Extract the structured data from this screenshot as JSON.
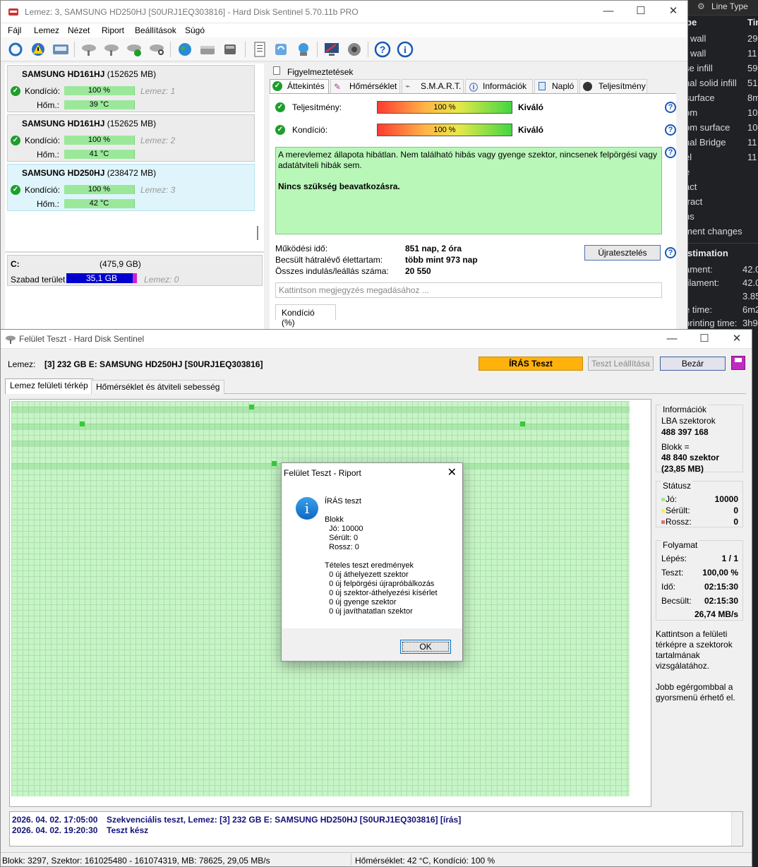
{
  "bg_app": {
    "header_label": "Line Type",
    "col_type": "pe",
    "col_time": "Tim",
    "rows": [
      {
        "name": "r wall",
        "value": "29"
      },
      {
        "name": "r wall",
        "value": "11"
      },
      {
        "name": "se infill",
        "value": "59"
      },
      {
        "name": "nal solid infill",
        "value": "51"
      },
      {
        "name": "surface",
        "value": "8m"
      },
      {
        "name": "om",
        "value": "10"
      },
      {
        "name": "om surface",
        "value": "10"
      },
      {
        "name": "nal Bridge",
        "value": "11"
      },
      {
        "name": "el",
        "value": "11"
      },
      {
        "name": "e",
        "value": ""
      },
      {
        "name": "act",
        "value": ""
      },
      {
        "name": "tract",
        "value": ""
      },
      {
        "name": "ns",
        "value": ""
      },
      {
        "name": "ment changes",
        "value": ""
      }
    ],
    "section_title": "stimation",
    "est_rows": [
      {
        "name": "ament:",
        "value": "42.0"
      },
      {
        "name": "filament:",
        "value": "42.0"
      },
      {
        "name": "",
        "value": "3.85"
      },
      {
        "name": "e time:",
        "value": "6m2"
      },
      {
        "name": "printing time:",
        "value": "3h9"
      }
    ]
  },
  "main_window": {
    "title": "Lemez: 3, SAMSUNG HD250HJ [S0URJ1EQ303816]  -  Hard Disk Sentinel 5.70.11b PRO",
    "menu": [
      "Fájl",
      "Lemez",
      "Nézet",
      "Riport",
      "Beállítások",
      "Súgó"
    ],
    "disks": [
      {
        "name": "SAMSUNG HD161HJ",
        "size": "(152625 MB)",
        "kondicio_label": "Kondíció:",
        "kondicio": "100 %",
        "hom_label": "Hőm.:",
        "hom": "39 °C",
        "lemez": "Lemez: 1"
      },
      {
        "name": "SAMSUNG HD161HJ",
        "size": "(152625 MB)",
        "kondicio_label": "Kondíció:",
        "kondicio": "100 %",
        "hom_label": "Hőm.:",
        "hom": "41 °C",
        "lemez": "Lemez: 2"
      },
      {
        "name": "SAMSUNG HD250HJ",
        "size": "(238472 MB)",
        "kondicio_label": "Kondíció:",
        "kondicio": "100 %",
        "hom_label": "Hőm.:",
        "hom": "42 °C",
        "lemez": "Lemez: 3"
      }
    ],
    "partition": {
      "drive": "C:",
      "size": "(475,9 GB)",
      "free_label": "Szabad terület",
      "free": "35,1 GB",
      "lemez": "Lemez: 0"
    },
    "tabs_top": {
      "figyelmeztetesek": "Figyelmeztetések"
    },
    "tabs": [
      "Áttekintés",
      "Hőmérséklet",
      "S.M.A.R.T.",
      "Információk",
      "Napló",
      "Teljesítmény"
    ],
    "teljesitmeny_label": "Teljesítmény:",
    "teljesitmeny_value": "100 %",
    "teljesitmeny_rating": "Kiváló",
    "kondicio_label": "Kondíció:",
    "kondicio_value": "100 %",
    "kondicio_rating": "Kiváló",
    "status_text": "A merevlemez állapota hibátlan. Nem található hibás vagy gyenge szektor, nincsenek felpörgési vagy adatátviteli hibák sem.",
    "status_bold": "Nincs szükség beavatkozásra.",
    "stats": [
      {
        "label": "Működési idő:",
        "value": "851 nap, 2 óra"
      },
      {
        "label": "Becsült hátralévő élettartam:",
        "value": "több mint 973 nap"
      },
      {
        "label": "Összes indulás/leállás száma:",
        "value": "20 550"
      }
    ],
    "retest_button": "Újratesztelés",
    "note_placeholder": "Kattintson megjegyzés megadásához ...",
    "kondicio_tab": "Kondíció  (%)"
  },
  "surface_window": {
    "title": "Felület Teszt - Hard Disk Sentinel",
    "lemez_label": "Lemez:",
    "lemez_value": "[3] 232 GB E: SAMSUNG HD250HJ [S0URJ1EQ303816]",
    "iras_button": "ÍRÁS Teszt",
    "stop_button": "Teszt Leállítása",
    "close_button": "Bezár",
    "tabs": [
      "Lemez felületi térkép",
      "Hőmérséklet és átviteli sebesség"
    ],
    "info": {
      "title": "Információk",
      "lba_label": "LBA szektorok",
      "lba_value": "488 397 168",
      "blokk_label": "Blokk =",
      "blokk_value": "48 840 szektor",
      "blokk_mb": "(23,85 MB)"
    },
    "status": {
      "title": "Státusz",
      "jo_label": "Jó:",
      "jo_value": "10000",
      "serult_label": "Sérült:",
      "serult_value": "0",
      "rossz_label": "Rossz:",
      "rossz_value": "0",
      "colors": {
        "jo": "#9be89b",
        "serult": "#f4f44a",
        "rossz": "#e87070"
      }
    },
    "progress": {
      "title": "Folyamat",
      "lepes_label": "Lépés:",
      "lepes_value": "1 / 1",
      "teszt_label": "Teszt:",
      "teszt_value": "100,00 %",
      "ido_label": "Idő:",
      "ido_value": "02:15:30",
      "becsult_label": "Becsült:",
      "becsult_value": "02:15:30",
      "speed": "26,74 MB/s"
    },
    "hint1": "Kattintson a felületi térképre a szektorok tartalmának vizsgálatához.",
    "hint2": "Jobb egérgombbal a gyorsmenü érhető el.",
    "log": [
      {
        "date": "2026. 04. 02.  17:05:00",
        "text": "Szekvenciális teszt, Lemez: [3] 232 GB E: SAMSUNG HD250HJ [S0URJ1EQ303816] [írás]"
      },
      {
        "date": "2026. 04. 02.  19:20:30",
        "text": "Teszt kész"
      }
    ],
    "statusbar_left": "Blokk: 3297, Szektor: 161025480 - 161074319, MB: 78625, 29,05 MB/s",
    "statusbar_right": "Hőmérséklet: 42  °C,  Kondíció: 100 %"
  },
  "dialog": {
    "title": "Felület Teszt - Riport",
    "lines": [
      "ÍRÁS teszt",
      "",
      "Blokk",
      "  Jó: 10000",
      "  Sérült: 0",
      "  Rossz: 0",
      "",
      "Tételes teszt eredmények",
      "  0 új áthelyezett szektor",
      "  0 új felpörgési újrapróbálkozás",
      "  0 új szektor-áthelyezési kísérlet",
      "  0 új gyenge szektor",
      "  0 új javíthatatlan szektor"
    ],
    "ok_button": "OK"
  }
}
